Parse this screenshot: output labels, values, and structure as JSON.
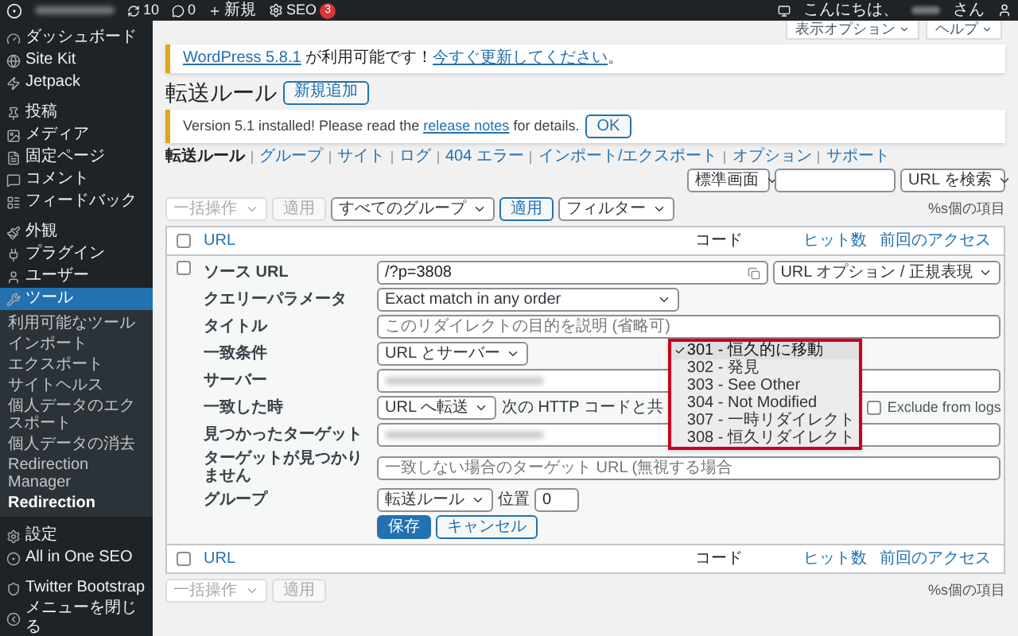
{
  "admin_bar": {
    "updates": "10",
    "comments": "0",
    "new": "新規",
    "seo": "SEO",
    "seo_badge": "3",
    "greeting": "こんにちは、",
    "greeting_suffix": "さん"
  },
  "sidebar": {
    "sections": [
      [
        {
          "label": "ダッシュボード",
          "selected": false
        },
        {
          "label": "Site Kit",
          "selected": false
        },
        {
          "label": "Jetpack",
          "selected": false
        }
      ],
      [
        {
          "label": "投稿",
          "selected": false
        },
        {
          "label": "メディア",
          "selected": false
        },
        {
          "label": "固定ページ",
          "selected": false
        },
        {
          "label": "コメント",
          "selected": false
        },
        {
          "label": "フィードバック",
          "selected": false
        }
      ],
      [
        {
          "label": "外観",
          "selected": false
        },
        {
          "label": "プラグイン",
          "selected": false
        },
        {
          "label": "ユーザー",
          "selected": false
        },
        {
          "label": "ツール",
          "selected": true,
          "children": [
            {
              "label": "利用可能なツール",
              "selected": false
            },
            {
              "label": "インポート",
              "selected": false
            },
            {
              "label": "エクスポート",
              "selected": false
            },
            {
              "label": "サイトヘルス",
              "selected": false
            },
            {
              "label": "個人データのエクスポート",
              "selected": false
            },
            {
              "label": "個人データの消去",
              "selected": false
            },
            {
              "label": "Redirection Manager",
              "selected": false
            },
            {
              "label": "Redirection",
              "selected": true
            }
          ]
        }
      ],
      [
        {
          "label": "設定",
          "selected": false
        },
        {
          "label": "All in One SEO",
          "selected": false
        }
      ],
      [
        {
          "label": "Twitter Bootstrap",
          "selected": false
        },
        {
          "label": "メニューを閉じる",
          "selected": false
        }
      ]
    ]
  },
  "screen_tabs": [
    "表示オプション",
    "ヘルプ"
  ],
  "update_notice": {
    "link": "WordPress 5.8.1",
    "text": " が利用可能です！",
    "action_link": "今すぐ更新してください",
    "end": "。"
  },
  "page_title": "転送ルール",
  "add_new": "新規追加",
  "version_notice": {
    "text": "Version 5.1 installed! Please read the",
    "link": "release notes",
    "text_after": "for details.",
    "button": "OK"
  },
  "subnav": [
    {
      "label": "転送ルール",
      "selected": true
    },
    {
      "label": "グループ",
      "selected": false
    },
    {
      "label": "サイト",
      "selected": false
    },
    {
      "label": "ログ",
      "selected": false
    },
    {
      "label": "404 エラー",
      "selected": false
    },
    {
      "label": "インポート/エクスポート",
      "selected": false
    },
    {
      "label": "オプション",
      "selected": false
    },
    {
      "label": "サポート",
      "selected": false
    }
  ],
  "top_controls": {
    "display_select": "標準画面",
    "search_select": "URL を検索"
  },
  "bulk": {
    "action": "一括操作",
    "apply": "適用",
    "group": "すべてのグループ",
    "apply_group": "適用",
    "filter": "フィルター"
  },
  "items_count": "%s個の項目",
  "table": {
    "select_all_checked": false,
    "columns": [
      "URL",
      "コード",
      "ヒット数",
      "前回のアクセス"
    ],
    "footer_select_all_checked": false,
    "footer_columns": [
      "URL",
      "コード",
      "ヒット数",
      "前回のアクセス"
    ]
  },
  "edit_form": {
    "checked": false,
    "fields": [
      {
        "label": "ソース URL",
        "controls": [
          {
            "kind": "input_icon",
            "value": "/?p=3808"
          },
          {
            "kind": "select",
            "value": "URL オプション / 正規表現"
          }
        ]
      },
      {
        "label": "クエリーパラメータ",
        "controls": [
          {
            "kind": "select_wide",
            "value": "Exact match in any order"
          }
        ]
      },
      {
        "label": "タイトル",
        "controls": [
          {
            "kind": "input",
            "placeholder": "このリダイレクトの目的を説明 (省略可)"
          }
        ]
      },
      {
        "label": "一致条件",
        "controls": [
          {
            "kind": "select",
            "value": "URL とサーバー"
          }
        ]
      },
      {
        "label": "サーバー",
        "controls": [
          {
            "kind": "blurred"
          }
        ]
      },
      {
        "label": "一致した時",
        "controls": [
          {
            "kind": "select",
            "value": "URL へ転送"
          },
          {
            "kind": "text",
            "value": "次の HTTP コードと共"
          },
          {
            "kind": "code_dropdown",
            "options": [
              {
                "label": "301 - 恒久的に移動",
                "selected": true
              },
              {
                "label": "302 - 発見",
                "selected": false
              },
              {
                "label": "303 - See Other",
                "selected": false
              },
              {
                "label": "304 - Not Modified",
                "selected": false
              },
              {
                "label": "307 - 一時リダイレクト",
                "selected": false
              },
              {
                "label": "308 - 恒久リダイレクト",
                "selected": false
              }
            ]
          },
          {
            "kind": "checkbox",
            "value": "Exclude from logs",
            "checked": false
          }
        ]
      },
      {
        "label": "見つかったターゲット",
        "controls": [
          {
            "kind": "blurred"
          }
        ]
      },
      {
        "label": "ターゲットが見つかりません",
        "controls": [
          {
            "kind": "input",
            "placeholder": "一致しない場合のターゲット URL (無視する場合"
          }
        ]
      },
      {
        "label": "グループ",
        "controls": [
          {
            "kind": "select",
            "value": "転送ルール"
          },
          {
            "kind": "text",
            "value": "位置"
          },
          {
            "kind": "number",
            "value": "0"
          }
        ]
      }
    ],
    "save": "保存",
    "cancel": "キャンセル"
  },
  "footer": {
    "bulk_action": "一括操作",
    "apply": "適用",
    "items_count": "%s個の項目"
  }
}
